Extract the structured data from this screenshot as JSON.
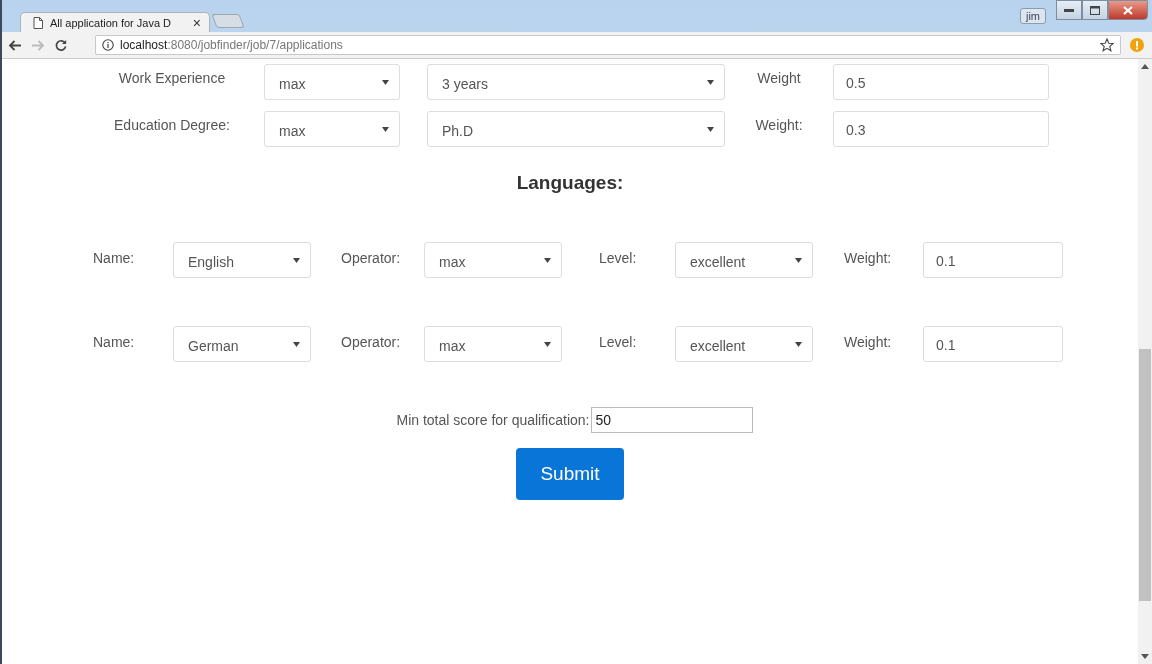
{
  "browser": {
    "tab_title": "All application for Java D",
    "tab_close": "×",
    "user_badge": "jim",
    "url_host": "localhost",
    "url_path": ":8080/jobfinder/job/7/applications"
  },
  "criteria": [
    {
      "label": "Work Experience",
      "operator": "max",
      "value": "3 years",
      "weight_label": "Weight",
      "weight": "0.5"
    },
    {
      "label": "Education Degree:",
      "operator": "max",
      "value": "Ph.D",
      "weight_label": "Weight:",
      "weight": "0.3"
    }
  ],
  "languages_heading": "Languages:",
  "languages": [
    {
      "name_label": "Name:",
      "name": "English",
      "operator_label": "Operator:",
      "operator": "max",
      "level_label": "Level:",
      "proficiency": "excellent",
      "weight_label": "Weight:",
      "weight": "0.1"
    },
    {
      "name_label": "Name:",
      "name": "German",
      "operator_label": "Operator:",
      "operator": "max",
      "level_label": "Level:",
      "proficiency": "excellent",
      "weight_label": "Weight:",
      "weight": "0.1"
    }
  ],
  "min_score": {
    "label": "Min total score for qualification:",
    "value": "50"
  },
  "submit": "Submit"
}
